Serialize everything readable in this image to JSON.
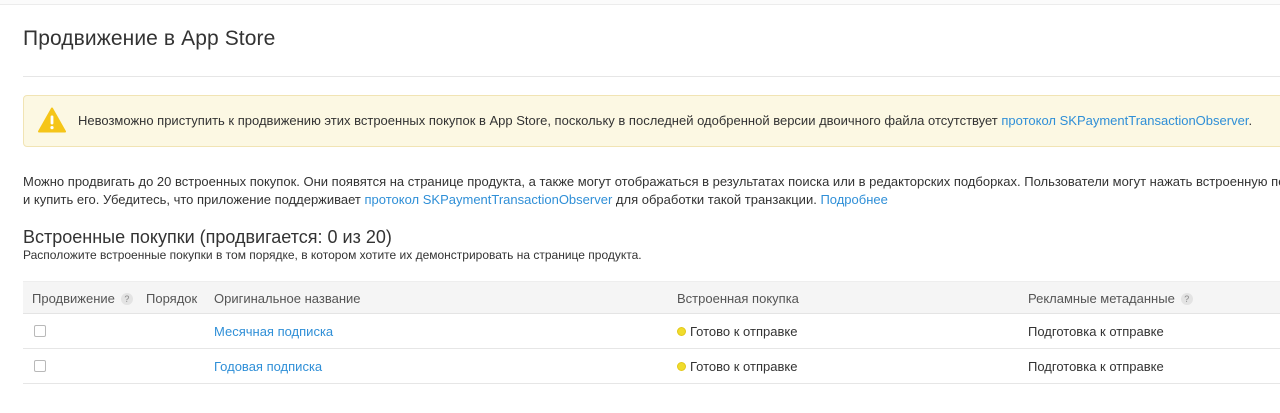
{
  "page": {
    "title": "Продвижение в App Store"
  },
  "warning": {
    "text": "Невозможно приступить к продвижению этих встроенных покупок в App Store, поскольку в последней одобренной версии двоичного файла отсутствует",
    "link": "протокол SKPaymentTransactionObserver",
    "end": "."
  },
  "description": {
    "line1": "Можно продвигать до 20 встроенных покупок. Они появятся на странице продукта, а также могут отображаться в результатах поиска или в редакторских подборках. Пользователи могут нажать встроенную покупку",
    "line2_start": "и купить его. Убедитесь, что приложение поддерживает",
    "line2_link": "протокол SKPaymentTransactionObserver",
    "line2_mid": "для обработки такой транзакции.",
    "line2_more": "Подробнее"
  },
  "section": {
    "title": "Встроенные покупки (продвигается: 0 из 20)",
    "subtitle": "Расположите встроенные покупки в том порядке, в котором хотите их демонстрировать на странице продукта."
  },
  "table": {
    "headers": {
      "promotion": "Продвижение",
      "order": "Порядок",
      "original_name": "Оригинальное название",
      "iap": "Встроенная покупка",
      "metadata": "Рекламные метаданные",
      "help": "?"
    },
    "rows": [
      {
        "name": "Месячная подписка",
        "status": "Готово к отправке",
        "metadata": "Подготовка к отправке",
        "checked": false
      },
      {
        "name": "Годовая подписка",
        "status": "Готово к отправке",
        "metadata": "Подготовка к отправке",
        "checked": false
      }
    ]
  },
  "colors": {
    "link": "#2f8fd7",
    "warning_bg": "#fcf8e3",
    "status_dot": "#f0dc2c",
    "warning_icon": "#f5c518"
  }
}
